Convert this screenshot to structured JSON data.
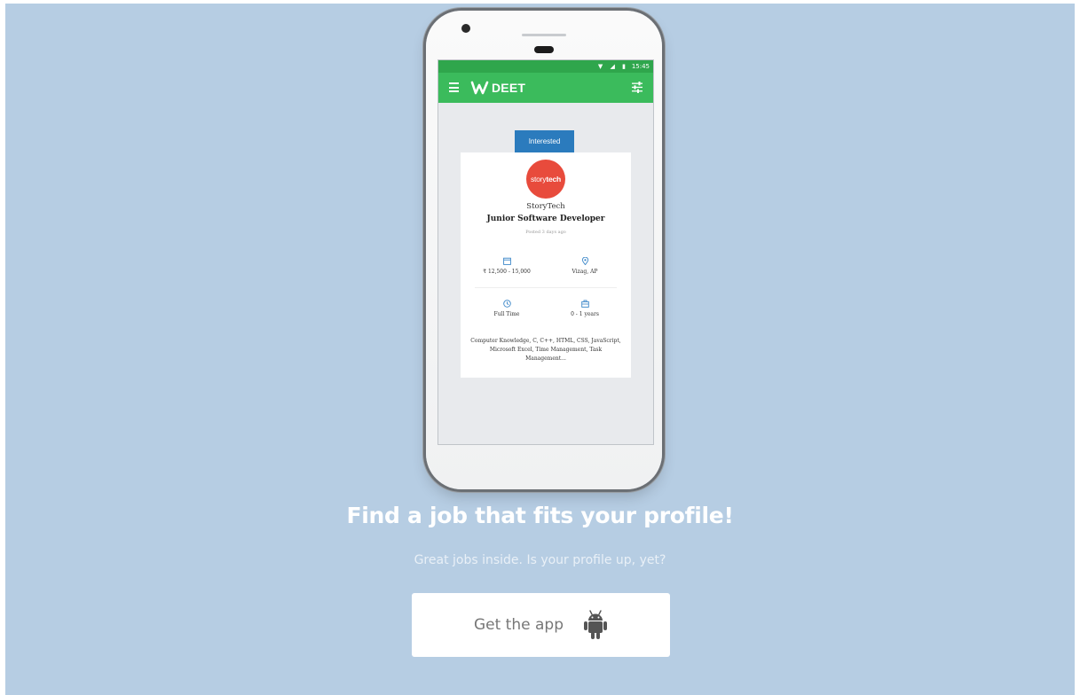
{
  "app": {
    "logo_text": "DEET",
    "status_time": "15:45",
    "status_icons": "▼ ◢ ▮"
  },
  "job_card": {
    "status_label": "Interested",
    "company_logo": {
      "part1": "story",
      "part2": "tech"
    },
    "company_name": "StoryTech",
    "title": "Junior Software Developer",
    "posted": "Posted 3 days ago",
    "salary": "₹ 12,500 - 15,000",
    "location": "Vizag, AP",
    "job_type": "Full Time",
    "experience": "0 - 1 years",
    "skills": "Computer Knowledge, C, C++, HTML, CSS, JavaScript, Microsoft Excel, Time Management, Task Management..."
  },
  "promo": {
    "headline": "Find a job that fits your profile!",
    "subline": "Great jobs inside. Is your profile up, yet?",
    "cta_label": "Get the app"
  },
  "colors": {
    "background": "#b6cde3",
    "app_bar": "#3bbb5c",
    "status_bar": "#2fa64c",
    "pill": "#2b7bbd",
    "company_logo": "#e84b3c",
    "icon_blue": "#3a86c8"
  },
  "icons": {
    "menu": "menu-icon",
    "filter": "filter-icon",
    "salary": "calendar-icon",
    "location": "location-pin-icon",
    "job_type": "clock-icon",
    "experience": "briefcase-icon",
    "cta": "android-icon"
  }
}
